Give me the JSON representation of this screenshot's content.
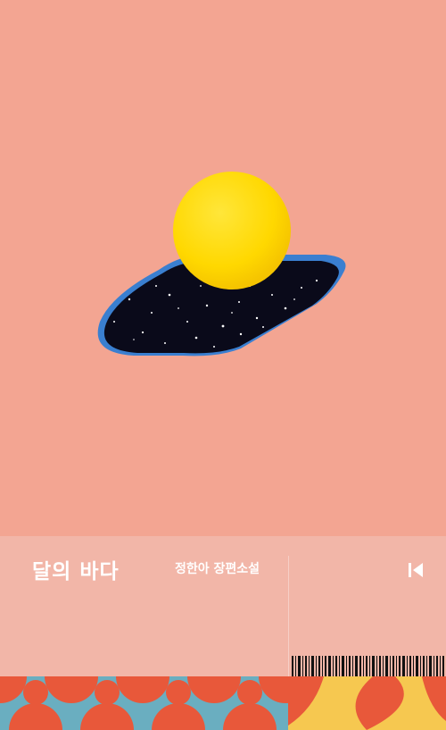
{
  "cover": {
    "title": "달의 바다",
    "author_line": "정한아 장편소설"
  },
  "icons": {
    "publisher_logo": "bracket-triangle-logo",
    "barcode": "barcode"
  },
  "colors": {
    "background": "#f3a592",
    "ticket": "#f2b6a8",
    "moon": "#ffdc00",
    "hole": "#0a0a1a",
    "hole_edge": "#3a7fd0",
    "pattern_orange": "#e8583a",
    "pattern_blue": "#6aaec0",
    "pattern_yellow": "#f6c850"
  }
}
